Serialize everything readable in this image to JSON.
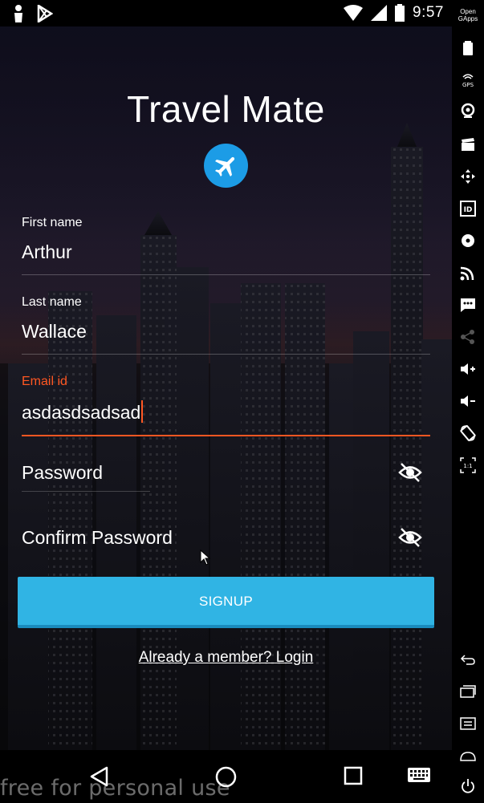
{
  "status_bar": {
    "time": "9:57",
    "icons": [
      "person-icon",
      "play-store-icon",
      "wifi-icon",
      "signal-icon",
      "battery-icon"
    ]
  },
  "app": {
    "title": "Travel Mate",
    "logo_icon": "airplane-icon",
    "fields": {
      "first_name": {
        "label": "First name",
        "value": "Arthur"
      },
      "last_name": {
        "label": "Last name",
        "value": "Wallace"
      },
      "email": {
        "label": "Email id",
        "value": "asdasdsadsad"
      }
    },
    "password": {
      "placeholder": "Password",
      "icon": "eye-off-icon"
    },
    "confirm_password": {
      "placeholder": "Confirm Password",
      "icon": "eye-off-icon"
    },
    "signup_label": "SIGNUP",
    "login_link": "Already a member? Login"
  },
  "watermark": "free for personal use",
  "nav_bar": [
    "back-icon",
    "home-icon",
    "recents-icon",
    "keyboard-icon"
  ],
  "side_toolbar": {
    "header": "Open GApps",
    "icons": [
      "battery-icon",
      "gps-icon",
      "camera-icon",
      "clapper-icon",
      "move-icon",
      "id-icon",
      "disk-icon",
      "cast-icon",
      "sms-icon",
      "share-icon",
      "volume-up-icon",
      "volume-down-icon",
      "rotate-icon",
      "scale-icon",
      "back-icon",
      "recents-icon",
      "menu-icon",
      "home-icon",
      "power-icon"
    ]
  },
  "colors": {
    "accent": "#ff5722",
    "button": "#30b4e4",
    "logo": "#1c9ce6"
  }
}
